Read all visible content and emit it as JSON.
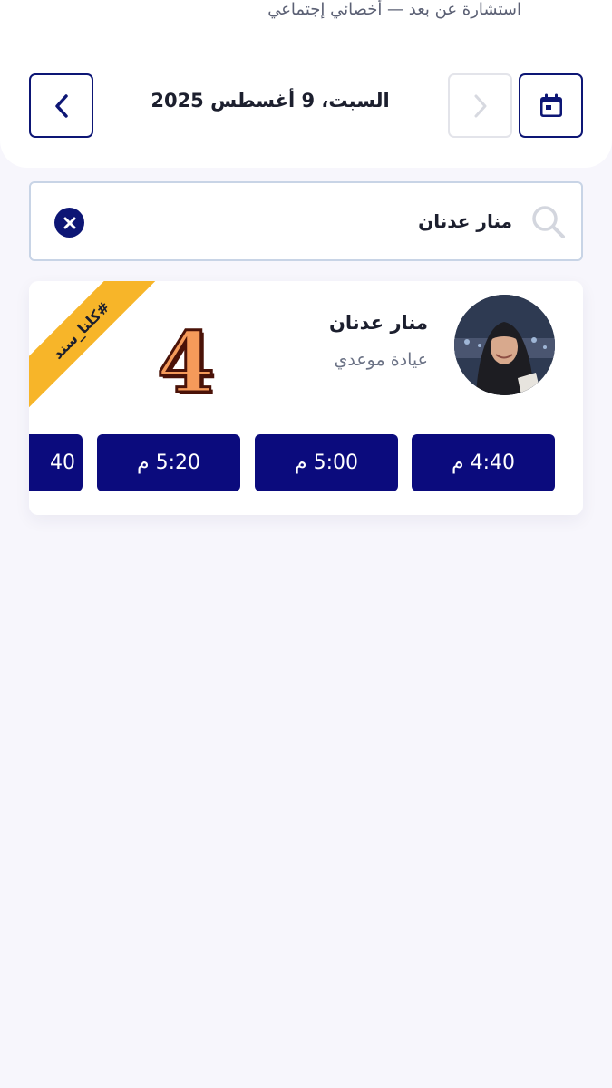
{
  "header": {
    "subtitle": "استشارة عن بعد — أخصائي إجتماعي",
    "date": "السبت، 9 أغسطس 2025",
    "icons": {
      "back": "back-arrow-icon",
      "prev": "chevron-left-icon",
      "next": "chevron-right-icon",
      "calendar": "calendar-icon"
    }
  },
  "search": {
    "value": "منار عدنان",
    "icons": {
      "search": "search-icon",
      "clear": "clear-icon"
    }
  },
  "doctor": {
    "name": "منار عدنان",
    "type": "عيادة موعدي",
    "ribbon": "#كلنا_سند",
    "count": "4",
    "slots": [
      "4:40 م",
      "5:00 م",
      "5:20 م",
      "40"
    ]
  },
  "colors": {
    "primary": "#0b0b7d",
    "ribbon": "#f7b529",
    "background": "#f7f6fc",
    "count_fill": "#f59a5a"
  }
}
